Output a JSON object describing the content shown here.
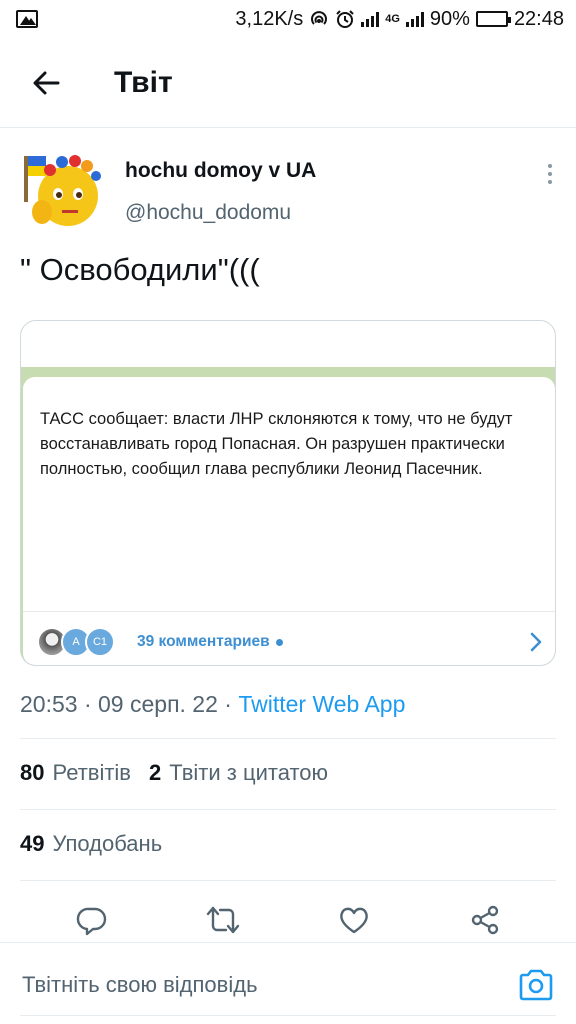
{
  "status_bar": {
    "speed": "3,12K/s",
    "network_label": "4G",
    "battery": "90%",
    "time": "22:48"
  },
  "header": {
    "title": "Твіт"
  },
  "tweet": {
    "author": {
      "display_name": "hochu domoy v UA",
      "handle": "@hochu_dodomu"
    },
    "text": "\" Освободили\"(((",
    "media": {
      "message_text": "ТАСС сообщает: власти ЛНР склоняются к тому, что не будут восстанавливать город Попасная. Он разрушен практически полностью, сообщил глава республики Леонид Пасечник.",
      "avatar_labels": [
        "А",
        "С1"
      ],
      "comments_label": "39 комментариев"
    },
    "meta": {
      "time": "20:53",
      "date": "09 серп. 22",
      "source": "Twitter Web App",
      "separator": " · "
    },
    "stats": {
      "retweets_count": "80",
      "retweets_label": "Ретвітів",
      "quotes_count": "2",
      "quotes_label": "Твіти з цитатою",
      "likes_count": "49",
      "likes_label": "Уподобань"
    }
  },
  "actions": [
    "reply-icon",
    "retweet-icon",
    "like-icon",
    "share-icon"
  ],
  "reply_bar": {
    "placeholder": "Твітніть свою відповідь"
  },
  "colors": {
    "accent": "#1d9bf0",
    "secondary_text": "#536471",
    "telegram_link": "#3d8fd1"
  }
}
